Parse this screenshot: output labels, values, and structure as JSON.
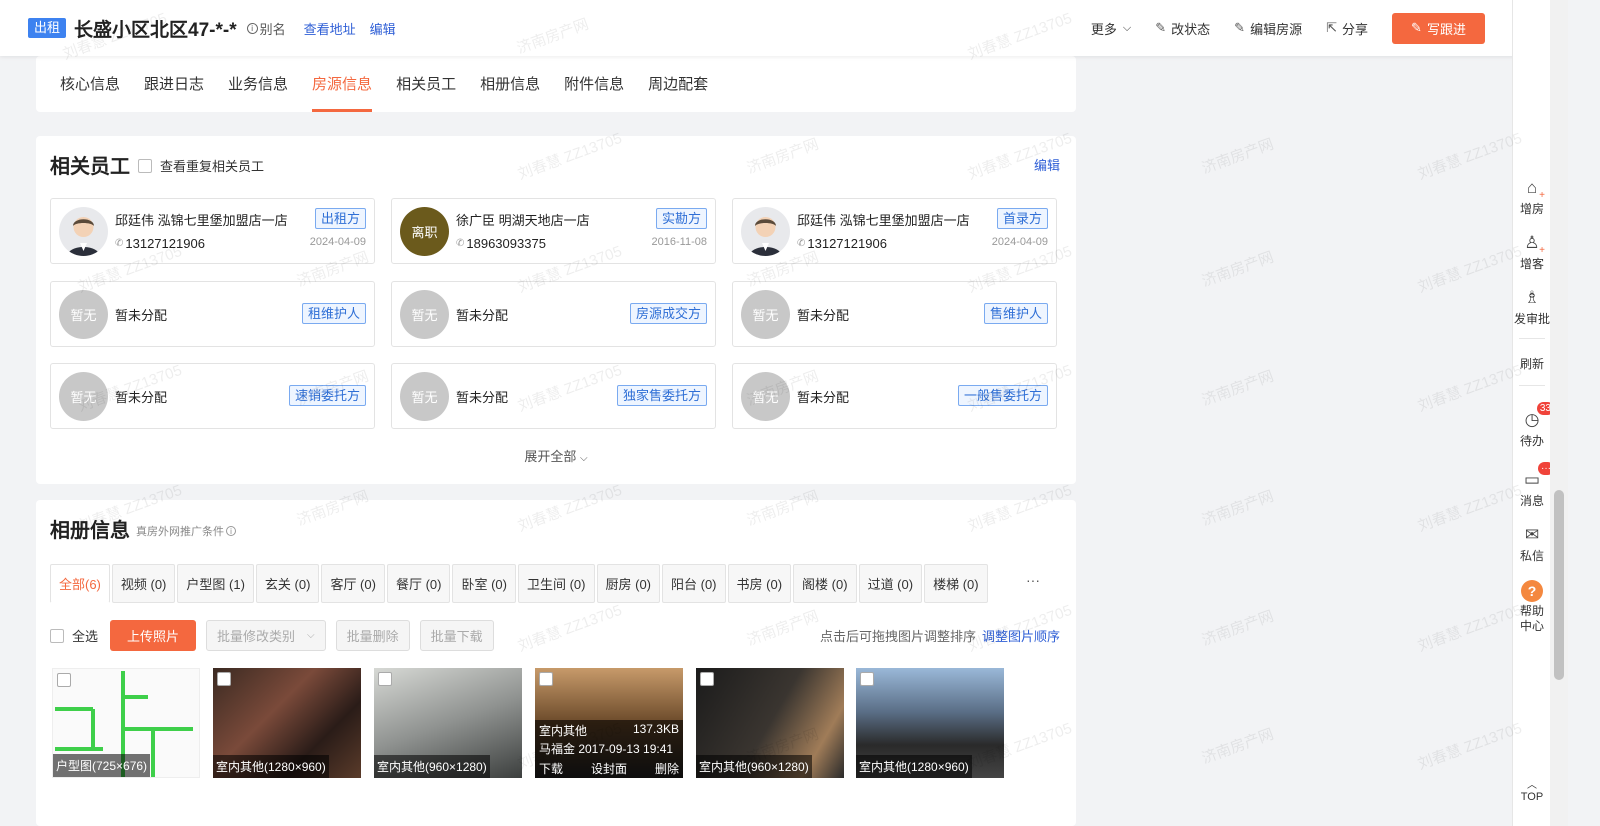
{
  "header": {
    "tag": "出租",
    "title": "长盛小区北区47-*-*",
    "alias": "别名",
    "view_address": "查看地址",
    "edit": "编辑",
    "more": "更多",
    "change_status": "改状态",
    "edit_listing": "编辑房源",
    "share": "分享",
    "write_followup": "写跟进"
  },
  "tabs": [
    "核心信息",
    "跟进日志",
    "业务信息",
    "房源信息",
    "相关员工",
    "相册信息",
    "附件信息",
    "周边配套"
  ],
  "active_tab": "房源信息",
  "staff_section": {
    "title": "相关员工",
    "view_duplicates": "查看重复相关员工",
    "edit": "编辑",
    "expand_all": "展开全部",
    "cards": [
      {
        "name": "邱廷伟 泓锦七里堡加盟店一店",
        "phone": "13127121906",
        "date": "2024-04-09",
        "role": "出租方",
        "avatar": ""
      },
      {
        "name": "徐广臣 明湖天地店一店",
        "phone": "18963093375",
        "date": "2016-11-08",
        "role": "实勘方",
        "avatar": "离职"
      },
      {
        "name": "邱廷伟 泓锦七里堡加盟店一店",
        "phone": "13127121906",
        "date": "2024-04-09",
        "role": "首录方",
        "avatar": ""
      },
      {
        "name": "暂未分配",
        "role": "租维护人",
        "avatar": "暂无"
      },
      {
        "name": "暂未分配",
        "role": "房源成交方",
        "avatar": "暂无"
      },
      {
        "name": "暂未分配",
        "role": "售维护人",
        "avatar": "暂无"
      },
      {
        "name": "暂未分配",
        "role": "速销委托方",
        "avatar": "暂无"
      },
      {
        "name": "暂未分配",
        "role": "独家售委托方",
        "avatar": "暂无"
      },
      {
        "name": "暂未分配",
        "role": "一般售委托方",
        "avatar": "暂无"
      }
    ]
  },
  "album_section": {
    "title": "相册信息",
    "subtitle": "真房外网推广条件",
    "categories": [
      "全部(6)",
      "视频 (0)",
      "户型图 (1)",
      "玄关 (0)",
      "客厅 (0)",
      "餐厅 (0)",
      "卧室 (0)",
      "卫生间 (0)",
      "厨房 (0)",
      "阳台 (0)",
      "书房 (0)",
      "阁楼 (0)",
      "过道 (0)",
      "楼梯 (0)"
    ],
    "more": "···",
    "select_all": "全选",
    "upload": "上传照片",
    "batch_modify": "批量修改类别",
    "batch_delete": "批量删除",
    "batch_download": "批量下载",
    "sort_tip": "点击后可拖拽图片调整排序",
    "sort_link": "调整图片顺序",
    "photos": [
      {
        "label": "户型图(725×676)"
      },
      {
        "label": "室内其他(1280×960)"
      },
      {
        "label": "室内其他(960×1280)"
      },
      {
        "label": "",
        "hover_type": "室内其他",
        "hover_size": "137.3KB",
        "hover_meta": "马福金 2017-09-13 19:41",
        "download": "下载",
        "set_cover": "设封面",
        "delete": "删除"
      },
      {
        "label": "室内其他(960×1280)"
      },
      {
        "label": "室内其他(1280×960)"
      }
    ]
  },
  "sidebar": {
    "add_house": "增房",
    "add_client": "增客",
    "approval": "发审批",
    "refresh": "刷新",
    "todo": "待办",
    "todo_badge": "33",
    "messages": "消息",
    "messages_badge": "···",
    "private_msg": "私信",
    "help_center": "帮助中心",
    "top": "TOP"
  },
  "watermark": {
    "name": "刘春慧 ZZ13705",
    "site": "济南房产网"
  },
  "colors": {
    "accent": "#f4683f",
    "link": "#2f5fd6",
    "tag_blue": "#3d82f0"
  }
}
